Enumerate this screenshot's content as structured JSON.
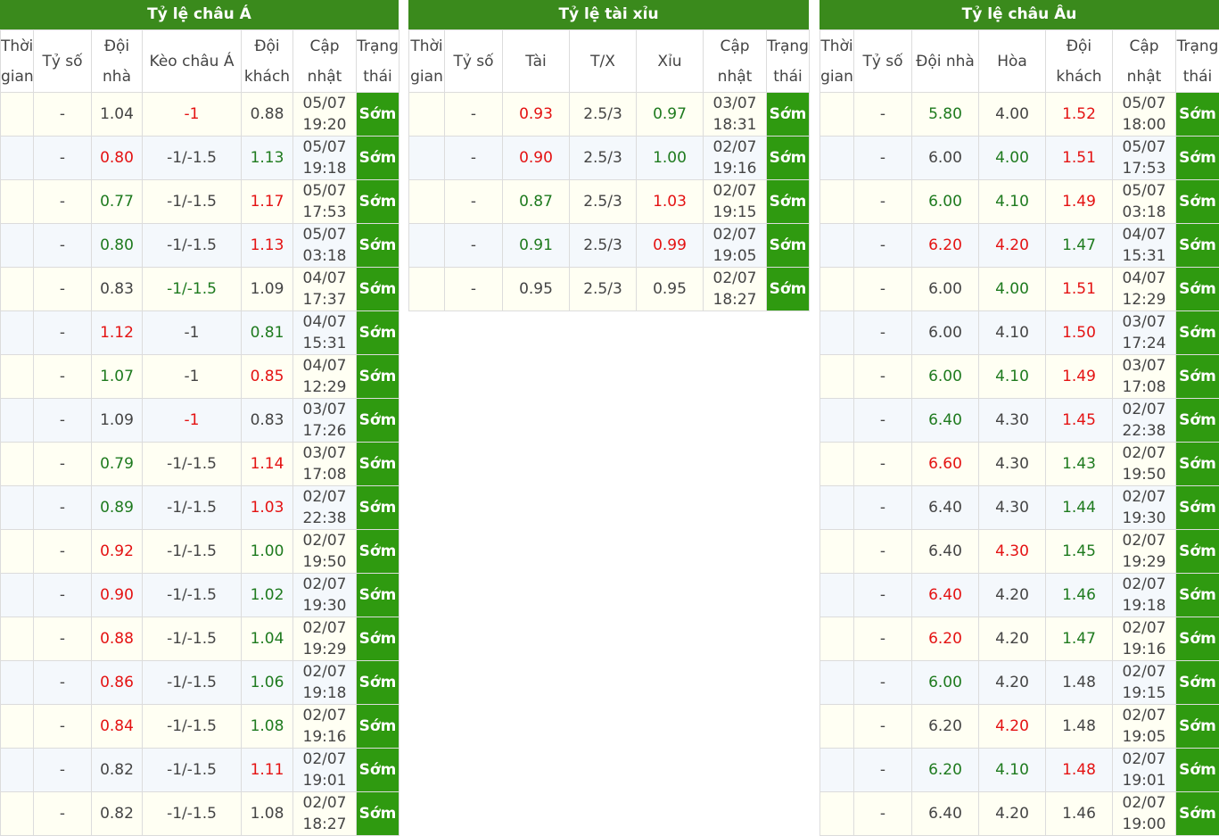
{
  "colors": {
    "header_green": "#3a8a1c",
    "status_green": "#2f9a10",
    "up_green": "#1e7a1e",
    "down_red": "#e41212"
  },
  "asian": {
    "title": "Tỷ lệ châu Á",
    "headers": [
      "Thời gian",
      "Tỷ số",
      "Đội nhà",
      "Kèo châu Á",
      "Đội khách",
      "Cập nhật",
      "Trạng thái"
    ],
    "rows": [
      {
        "time": "",
        "score": "-",
        "home": "1.04",
        "home_c": "normal",
        "line": "-1",
        "line_c": "red",
        "away": "0.88",
        "away_c": "normal",
        "update": "05/07 19:20",
        "status": "Sớm"
      },
      {
        "time": "",
        "score": "-",
        "home": "0.80",
        "home_c": "red",
        "line": "-1/-1.5",
        "line_c": "normal",
        "away": "1.13",
        "away_c": "green",
        "update": "05/07 19:18",
        "status": "Sớm"
      },
      {
        "time": "",
        "score": "-",
        "home": "0.77",
        "home_c": "green",
        "line": "-1/-1.5",
        "line_c": "normal",
        "away": "1.17",
        "away_c": "red",
        "update": "05/07 17:53",
        "status": "Sớm"
      },
      {
        "time": "",
        "score": "-",
        "home": "0.80",
        "home_c": "green",
        "line": "-1/-1.5",
        "line_c": "normal",
        "away": "1.13",
        "away_c": "red",
        "update": "05/07 03:18",
        "status": "Sớm"
      },
      {
        "time": "",
        "score": "-",
        "home": "0.83",
        "home_c": "normal",
        "line": "-1/-1.5",
        "line_c": "green",
        "away": "1.09",
        "away_c": "normal",
        "update": "04/07 17:37",
        "status": "Sớm"
      },
      {
        "time": "",
        "score": "-",
        "home": "1.12",
        "home_c": "red",
        "line": "-1",
        "line_c": "normal",
        "away": "0.81",
        "away_c": "green",
        "update": "04/07 15:31",
        "status": "Sớm"
      },
      {
        "time": "",
        "score": "-",
        "home": "1.07",
        "home_c": "green",
        "line": "-1",
        "line_c": "normal",
        "away": "0.85",
        "away_c": "red",
        "update": "04/07 12:29",
        "status": "Sớm"
      },
      {
        "time": "",
        "score": "-",
        "home": "1.09",
        "home_c": "normal",
        "line": "-1",
        "line_c": "red",
        "away": "0.83",
        "away_c": "normal",
        "update": "03/07 17:26",
        "status": "Sớm"
      },
      {
        "time": "",
        "score": "-",
        "home": "0.79",
        "home_c": "green",
        "line": "-1/-1.5",
        "line_c": "normal",
        "away": "1.14",
        "away_c": "red",
        "update": "03/07 17:08",
        "status": "Sớm"
      },
      {
        "time": "",
        "score": "-",
        "home": "0.89",
        "home_c": "green",
        "line": "-1/-1.5",
        "line_c": "normal",
        "away": "1.03",
        "away_c": "red",
        "update": "02/07 22:38",
        "status": "Sớm"
      },
      {
        "time": "",
        "score": "-",
        "home": "0.92",
        "home_c": "red",
        "line": "-1/-1.5",
        "line_c": "normal",
        "away": "1.00",
        "away_c": "green",
        "update": "02/07 19:50",
        "status": "Sớm"
      },
      {
        "time": "",
        "score": "-",
        "home": "0.90",
        "home_c": "red",
        "line": "-1/-1.5",
        "line_c": "normal",
        "away": "1.02",
        "away_c": "green",
        "update": "02/07 19:30",
        "status": "Sớm"
      },
      {
        "time": "",
        "score": "-",
        "home": "0.88",
        "home_c": "red",
        "line": "-1/-1.5",
        "line_c": "normal",
        "away": "1.04",
        "away_c": "green",
        "update": "02/07 19:29",
        "status": "Sớm"
      },
      {
        "time": "",
        "score": "-",
        "home": "0.86",
        "home_c": "red",
        "line": "-1/-1.5",
        "line_c": "normal",
        "away": "1.06",
        "away_c": "green",
        "update": "02/07 19:18",
        "status": "Sớm"
      },
      {
        "time": "",
        "score": "-",
        "home": "0.84",
        "home_c": "red",
        "line": "-1/-1.5",
        "line_c": "normal",
        "away": "1.08",
        "away_c": "green",
        "update": "02/07 19:16",
        "status": "Sớm"
      },
      {
        "time": "",
        "score": "-",
        "home": "0.82",
        "home_c": "normal",
        "line": "-1/-1.5",
        "line_c": "normal",
        "away": "1.11",
        "away_c": "red",
        "update": "02/07 19:01",
        "status": "Sớm"
      },
      {
        "time": "",
        "score": "-",
        "home": "0.82",
        "home_c": "normal",
        "line": "-1/-1.5",
        "line_c": "normal",
        "away": "1.08",
        "away_c": "normal",
        "update": "02/07 18:27",
        "status": "Sớm"
      }
    ]
  },
  "overunder": {
    "title": "Tỷ lệ tài xỉu",
    "headers": [
      "Thời gian",
      "Tỷ số",
      "Tài",
      "T/X",
      "Xỉu",
      "Cập nhật",
      "Trạng thái"
    ],
    "rows": [
      {
        "time": "",
        "score": "-",
        "over": "0.93",
        "over_c": "red",
        "line": "2.5/3",
        "under": "0.97",
        "under_c": "green",
        "update": "03/07 18:31",
        "status": "Sớm"
      },
      {
        "time": "",
        "score": "-",
        "over": "0.90",
        "over_c": "red",
        "line": "2.5/3",
        "under": "1.00",
        "under_c": "green",
        "update": "02/07 19:16",
        "status": "Sớm"
      },
      {
        "time": "",
        "score": "-",
        "over": "0.87",
        "over_c": "green",
        "line": "2.5/3",
        "under": "1.03",
        "under_c": "red",
        "update": "02/07 19:15",
        "status": "Sớm"
      },
      {
        "time": "",
        "score": "-",
        "over": "0.91",
        "over_c": "green",
        "line": "2.5/3",
        "under": "0.99",
        "under_c": "red",
        "update": "02/07 19:05",
        "status": "Sớm"
      },
      {
        "time": "",
        "score": "-",
        "over": "0.95",
        "over_c": "normal",
        "line": "2.5/3",
        "under": "0.95",
        "under_c": "normal",
        "update": "02/07 18:27",
        "status": "Sớm"
      }
    ]
  },
  "european": {
    "title": "Tỷ lệ châu Âu",
    "headers": [
      "Thời gian",
      "Tỷ số",
      "Đội nhà",
      "Hòa",
      "Đội khách",
      "Cập nhật",
      "Trạng thái"
    ],
    "rows": [
      {
        "time": "",
        "score": "-",
        "home": "5.80",
        "home_c": "green",
        "draw": "4.00",
        "draw_c": "normal",
        "away": "1.52",
        "away_c": "red",
        "update": "05/07 18:00",
        "status": "Sớm"
      },
      {
        "time": "",
        "score": "-",
        "home": "6.00",
        "home_c": "normal",
        "draw": "4.00",
        "draw_c": "green",
        "away": "1.51",
        "away_c": "red",
        "update": "05/07 17:53",
        "status": "Sớm"
      },
      {
        "time": "",
        "score": "-",
        "home": "6.00",
        "home_c": "green",
        "draw": "4.10",
        "draw_c": "green",
        "away": "1.49",
        "away_c": "red",
        "update": "05/07 03:18",
        "status": "Sớm"
      },
      {
        "time": "",
        "score": "-",
        "home": "6.20",
        "home_c": "red",
        "draw": "4.20",
        "draw_c": "red",
        "away": "1.47",
        "away_c": "green",
        "update": "04/07 15:31",
        "status": "Sớm"
      },
      {
        "time": "",
        "score": "-",
        "home": "6.00",
        "home_c": "normal",
        "draw": "4.00",
        "draw_c": "green",
        "away": "1.51",
        "away_c": "red",
        "update": "04/07 12:29",
        "status": "Sớm"
      },
      {
        "time": "",
        "score": "-",
        "home": "6.00",
        "home_c": "normal",
        "draw": "4.10",
        "draw_c": "normal",
        "away": "1.50",
        "away_c": "red",
        "update": "03/07 17:24",
        "status": "Sớm"
      },
      {
        "time": "",
        "score": "-",
        "home": "6.00",
        "home_c": "green",
        "draw": "4.10",
        "draw_c": "green",
        "away": "1.49",
        "away_c": "red",
        "update": "03/07 17:08",
        "status": "Sớm"
      },
      {
        "time": "",
        "score": "-",
        "home": "6.40",
        "home_c": "green",
        "draw": "4.30",
        "draw_c": "normal",
        "away": "1.45",
        "away_c": "red",
        "update": "02/07 22:38",
        "status": "Sớm"
      },
      {
        "time": "",
        "score": "-",
        "home": "6.60",
        "home_c": "red",
        "draw": "4.30",
        "draw_c": "normal",
        "away": "1.43",
        "away_c": "green",
        "update": "02/07 19:50",
        "status": "Sớm"
      },
      {
        "time": "",
        "score": "-",
        "home": "6.40",
        "home_c": "normal",
        "draw": "4.30",
        "draw_c": "normal",
        "away": "1.44",
        "away_c": "green",
        "update": "02/07 19:30",
        "status": "Sớm"
      },
      {
        "time": "",
        "score": "-",
        "home": "6.40",
        "home_c": "normal",
        "draw": "4.30",
        "draw_c": "red",
        "away": "1.45",
        "away_c": "green",
        "update": "02/07 19:29",
        "status": "Sớm"
      },
      {
        "time": "",
        "score": "-",
        "home": "6.40",
        "home_c": "red",
        "draw": "4.20",
        "draw_c": "normal",
        "away": "1.46",
        "away_c": "green",
        "update": "02/07 19:18",
        "status": "Sớm"
      },
      {
        "time": "",
        "score": "-",
        "home": "6.20",
        "home_c": "red",
        "draw": "4.20",
        "draw_c": "normal",
        "away": "1.47",
        "away_c": "green",
        "update": "02/07 19:16",
        "status": "Sớm"
      },
      {
        "time": "",
        "score": "-",
        "home": "6.00",
        "home_c": "green",
        "draw": "4.20",
        "draw_c": "normal",
        "away": "1.48",
        "away_c": "normal",
        "update": "02/07 19:15",
        "status": "Sớm"
      },
      {
        "time": "",
        "score": "-",
        "home": "6.20",
        "home_c": "normal",
        "draw": "4.20",
        "draw_c": "red",
        "away": "1.48",
        "away_c": "normal",
        "update": "02/07 19:05",
        "status": "Sớm"
      },
      {
        "time": "",
        "score": "-",
        "home": "6.20",
        "home_c": "green",
        "draw": "4.10",
        "draw_c": "green",
        "away": "1.48",
        "away_c": "red",
        "update": "02/07 19:01",
        "status": "Sớm"
      },
      {
        "time": "",
        "score": "-",
        "home": "6.40",
        "home_c": "normal",
        "draw": "4.20",
        "draw_c": "normal",
        "away": "1.46",
        "away_c": "normal",
        "update": "02/07 19:00",
        "status": "Sớm"
      }
    ]
  }
}
